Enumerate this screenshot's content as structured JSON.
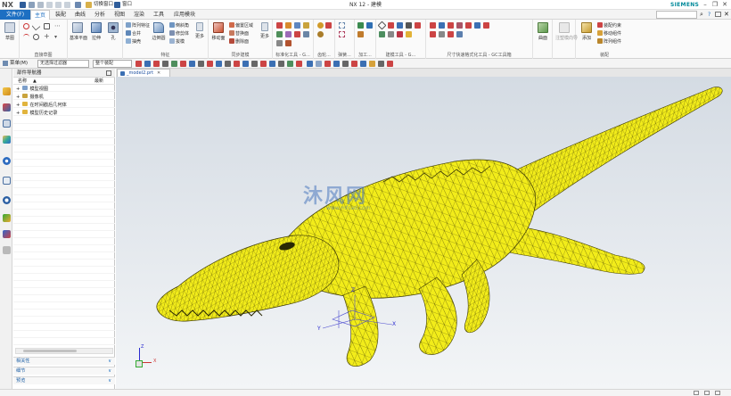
{
  "app": {
    "logo": "NX",
    "window_title": "NX 12 - 建模",
    "brand": "SIEMENS",
    "window_menu_1": "切换窗口",
    "window_menu_2": "窗口"
  },
  "menu": {
    "file": "文件(F)",
    "tabs": [
      "主页",
      "装配",
      "曲线",
      "分析",
      "视图",
      "渲染",
      "工具",
      "应用模块"
    ],
    "search_placeholder": ""
  },
  "ribbon": {
    "groups": [
      {
        "label": "",
        "buttons": [
          "草图"
        ]
      },
      {
        "label": "直接草图",
        "buttons": []
      },
      {
        "label": "",
        "buttons": [
          "基准平面",
          "拉伸",
          "孔"
        ]
      },
      {
        "label": "特征",
        "small": [
          "阵列特征",
          "合并",
          "抽壳"
        ],
        "buttons": [
          "边倒圆"
        ],
        "small2": [
          "倒斜角",
          "修剪体",
          "拔模"
        ],
        "more": "更多"
      },
      {
        "label": "同步建模",
        "buttons": [
          "移动面"
        ],
        "small": [
          "偏置区域",
          "替换面",
          "删除面"
        ],
        "more": "更多"
      },
      {
        "label": "标准化工具 - G...",
        "buttons": []
      },
      {
        "label": "齿轮...",
        "buttons": []
      },
      {
        "label": "弹簧...",
        "buttons": []
      },
      {
        "label": "加工...",
        "buttons": []
      },
      {
        "label": "建模工具 - G...",
        "buttons": []
      },
      {
        "label": "尺寸快速格式化工具 - GC工具箱",
        "buttons": []
      },
      {
        "label": "",
        "buttons": [
          "曲面"
        ]
      },
      {
        "label": "",
        "buttons": [
          "注塑模向导"
        ]
      },
      {
        "label": "装配",
        "buttons": [
          "添加"
        ],
        "small": [
          "装配约束",
          "移动组件",
          "阵列组件"
        ]
      }
    ]
  },
  "toolbar2": {
    "menu": "菜单(M)",
    "filter": "无选择过滤器",
    "scope": "整个装配"
  },
  "navigator": {
    "title": "部件导航器",
    "col_name": "名称",
    "col_latest": "最新",
    "items": [
      "模型视图",
      "摄像机",
      "在时间戳后几何体",
      "模型历史记录"
    ],
    "accordion": [
      "相关性",
      "细节",
      "预览"
    ]
  },
  "viewport": {
    "tab_label": "_model2.prt",
    "watermark_title": "沐风网",
    "watermark_url": "www.mfcad.com",
    "axis_labels": [
      "X",
      "Y",
      "Z"
    ]
  },
  "colors": {
    "accent": "#1d6fc2",
    "model_fill": "#f2ec1a",
    "mesh_line": "#3d3a06",
    "brand": "#00899a"
  }
}
